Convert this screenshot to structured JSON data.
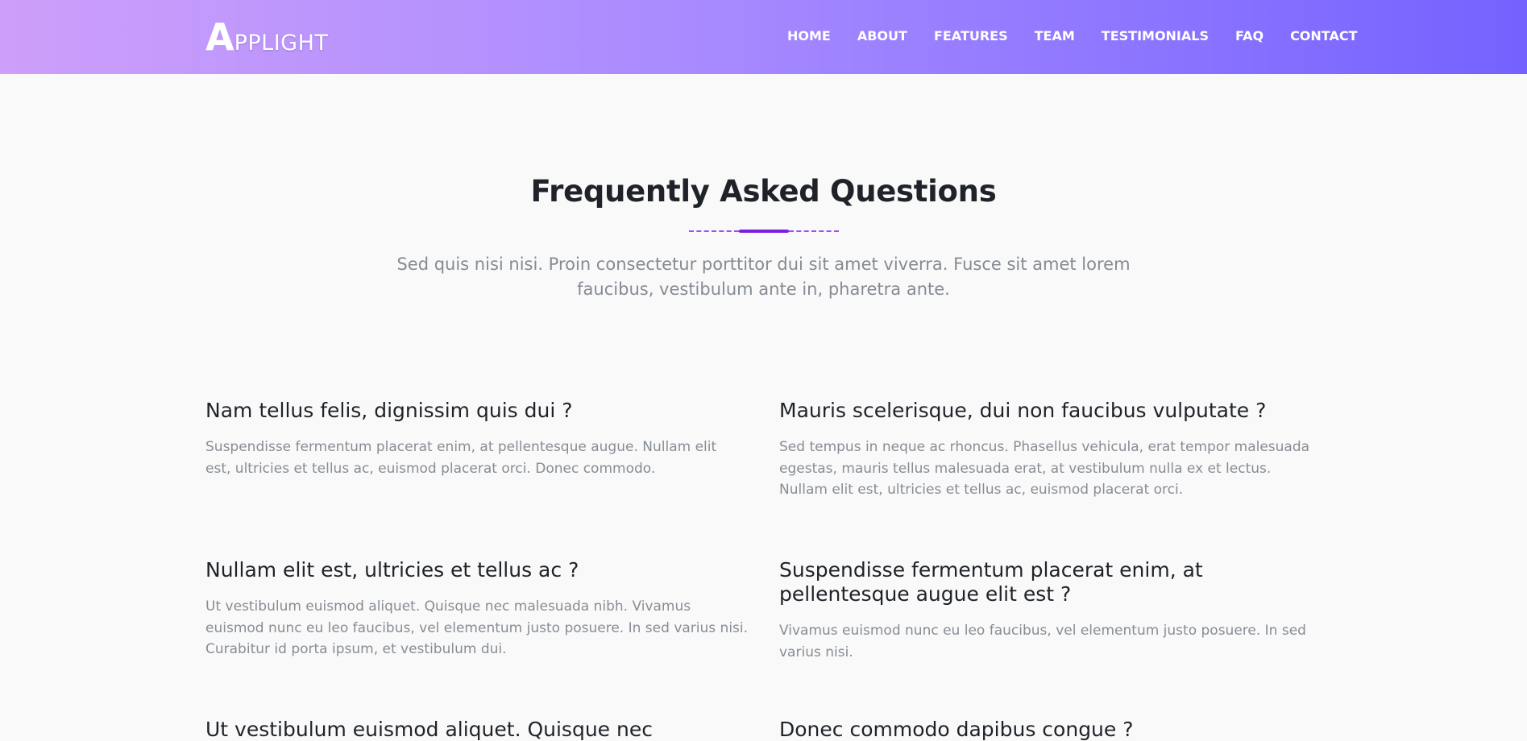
{
  "brand": {
    "initial": "A",
    "rest": "PPLIGHT"
  },
  "nav": {
    "items": [
      "HOME",
      "ABOUT",
      "FEATURES",
      "TEAM",
      "TESTIMONIALS",
      "FAQ",
      "CONTACT"
    ]
  },
  "section": {
    "title": "Frequently Asked Questions",
    "subtitle_line1": "Sed quis nisi nisi. Proin consectetur porttitor dui sit amet viverra. Fusce sit amet lorem",
    "subtitle_line2": "faucibus, vestibulum ante in, pharetra ante."
  },
  "faqs": [
    {
      "question": "Nam tellus felis, dignissim quis dui ?",
      "answer_lines": [
        "Suspendisse fermentum placerat enim, at pellentesque augue. Nullam elit",
        "est, ultricies et tellus ac, euismod placerat orci. Donec commodo."
      ]
    },
    {
      "question": "Mauris scelerisque, dui non faucibus vulputate ?",
      "answer_lines": [
        "Sed tempus in neque ac rhoncus. Phasellus vehicula, erat tempor malesuada",
        "egestas, mauris tellus malesuada erat, at vestibulum nulla ex et lectus.",
        "Nullam elit est, ultricies et tellus ac, euismod placerat orci."
      ]
    },
    {
      "question": "Nullam elit est, ultricies et tellus ac ?",
      "answer_lines": [
        "Ut vestibulum euismod aliquet. Quisque nec malesuada nibh. Vivamus",
        "euismod nunc eu leo faucibus, vel elementum justo posuere. In sed varius nisi.",
        "Curabitur id porta ipsum, et vestibulum dui."
      ]
    },
    {
      "question_lines": [
        "Suspendisse fermentum placerat enim, at",
        "pellentesque augue elit est ?"
      ],
      "answer_lines": [
        "Vivamus euismod nunc eu leo faucibus, vel elementum justo posuere. In sed",
        "varius nisi."
      ]
    },
    {
      "question": "Ut vestibulum euismod aliquet. Quisque nec",
      "answer_lines": []
    },
    {
      "question": "Donec commodo dapibus congue ?",
      "answer_lines": []
    }
  ]
}
